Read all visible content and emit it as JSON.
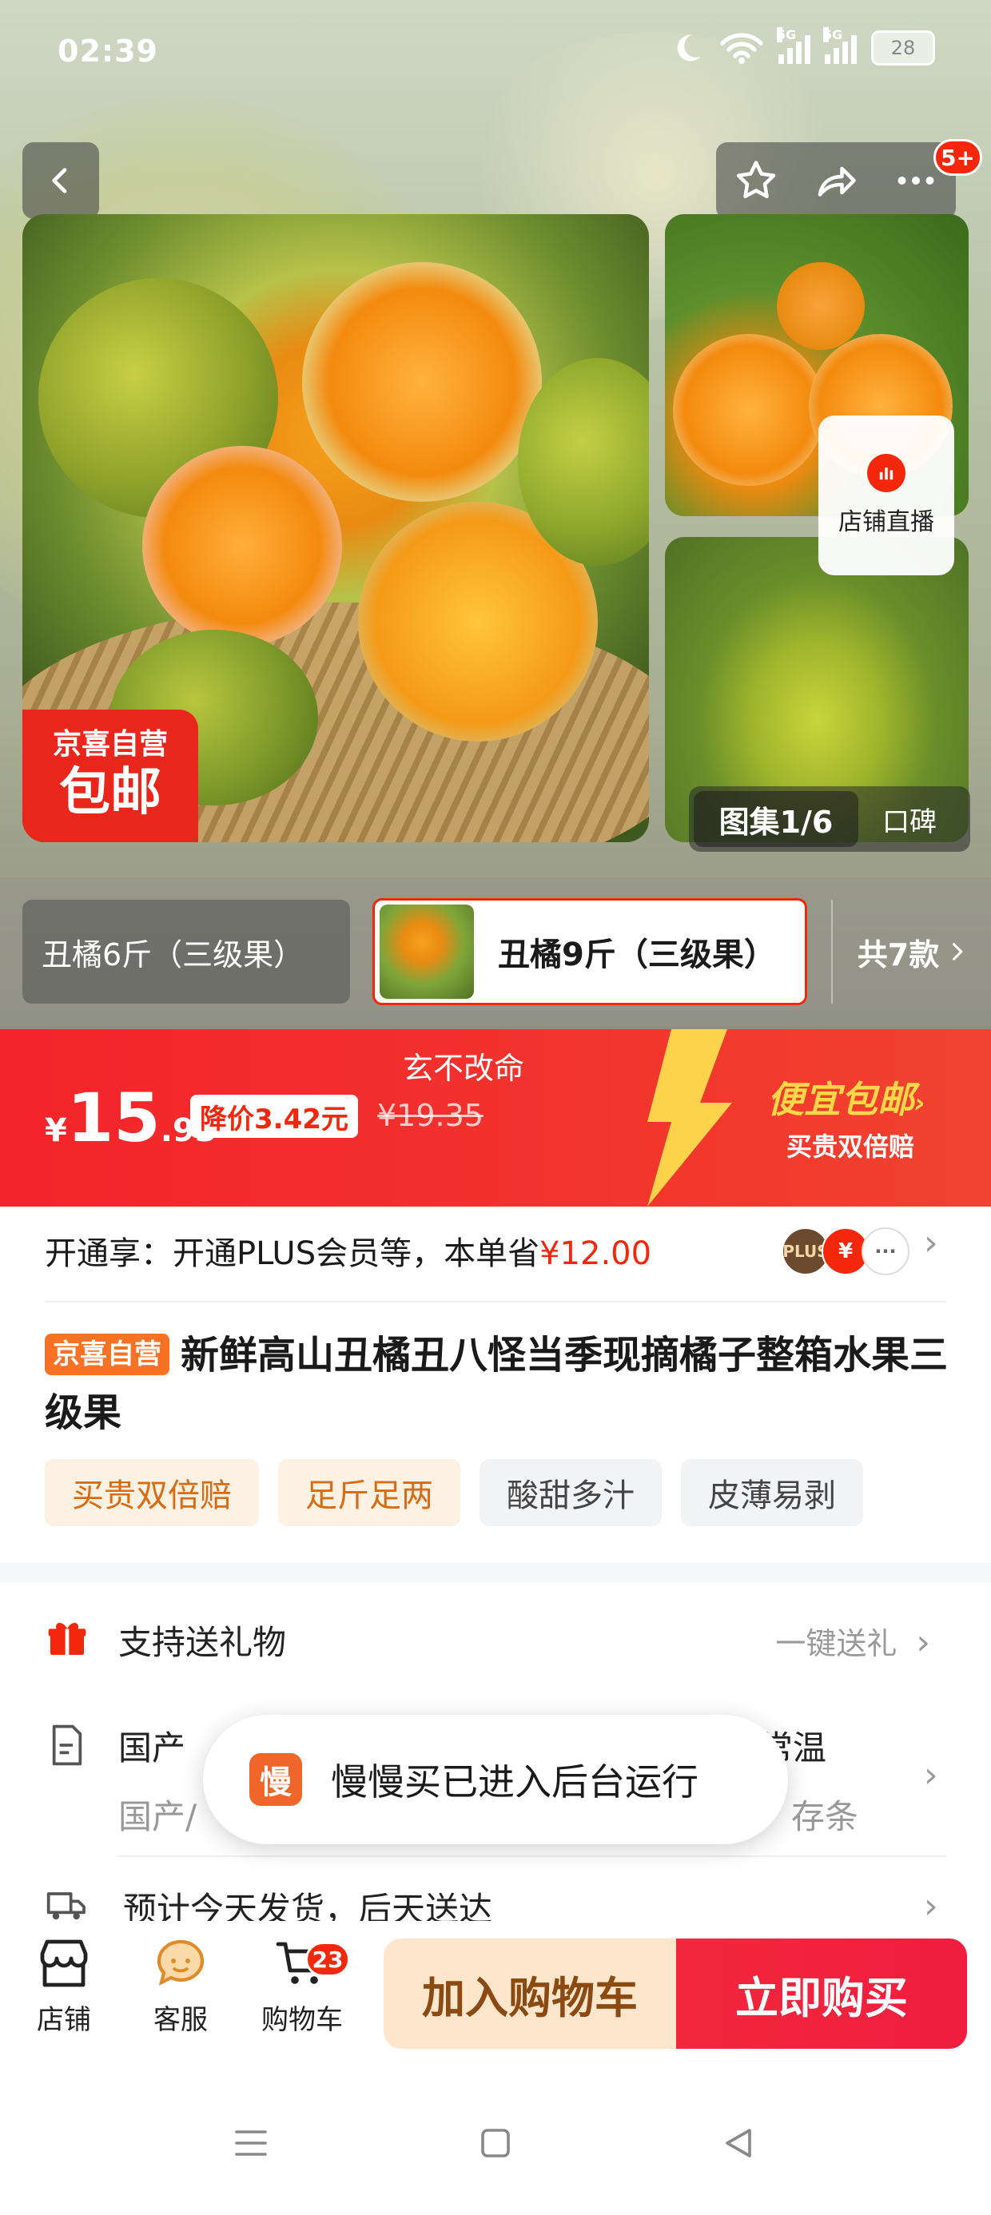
{
  "status_bar": {
    "time": "02:39",
    "battery": "28",
    "net1": "5G",
    "net2": "5G"
  },
  "header": {
    "message_badge": "5+"
  },
  "gallery": {
    "self_run_tag": "京喜自营",
    "free_ship_tag": "包邮",
    "live_label": "店铺直播",
    "gallery_label": "图集1/6",
    "review_label": "口碑"
  },
  "sku": {
    "option1": "丑橘6斤（三级果）",
    "option2": "丑橘9斤（三级果）",
    "more": "共7款"
  },
  "price_banner": {
    "slogan": "玄不改命",
    "currency": "¥",
    "price_int": "15",
    "price_dec": ".93",
    "drop_tag": "降价3.42元",
    "original_price": "¥19.35",
    "promo_title": "便宜包邮",
    "promo_sub": "买贵双倍赔"
  },
  "plus": {
    "text_prefix": "开通享：开通PLUS会员等，本单省",
    "saving": "¥12.00",
    "icon1": "PLUS",
    "icon2": "¥",
    "icon3": "···"
  },
  "product": {
    "tag": "京喜自营",
    "title": "新鲜高山丑橘丑八怪当季现摘橘子整箱水果三级果",
    "chips": [
      "买贵双倍赔",
      "足斤足两",
      "酸甜多汁",
      "皮薄易剥"
    ]
  },
  "services": {
    "gift_label": "支持送礼物",
    "gift_action": "一键送礼",
    "origin_line1": "国产",
    "origin_line1_tail": "常温",
    "origin_line2": "国产/",
    "origin_line2_tail": "存条",
    "shipping": "预计今天发货，后天送达"
  },
  "toast": {
    "logo_text": "慢",
    "message": "慢慢买已进入后台运行"
  },
  "bottom_bar": {
    "store": "店铺",
    "service": "客服",
    "cart": "购物车",
    "cart_count": "23",
    "add_to_cart": "加入购物车",
    "buy_now": "立即购买"
  },
  "colors": {
    "brand_red": "#f2270c",
    "orange_tag": "#f87226",
    "promo_yellow": "#ffd84a"
  }
}
